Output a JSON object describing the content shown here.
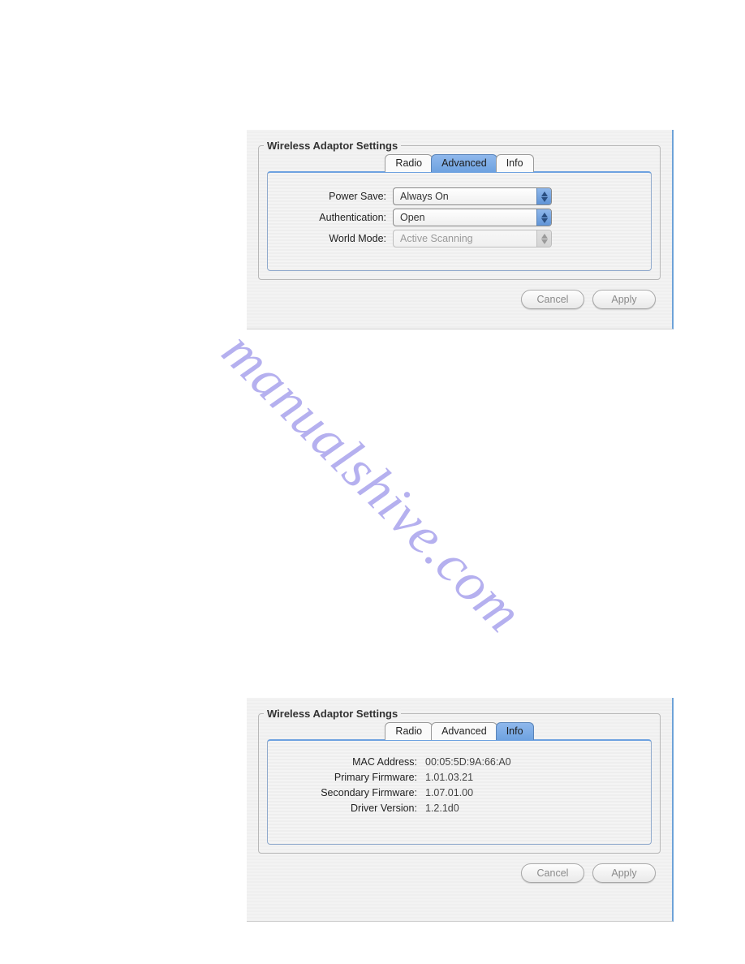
{
  "watermark": "manualshive.com",
  "panel1": {
    "group_title": "Wireless Adaptor Settings",
    "tabs": {
      "radio": "Radio",
      "advanced": "Advanced",
      "info": "Info"
    },
    "active_tab": "advanced",
    "rows": {
      "power_save": {
        "label": "Power Save:",
        "value": "Always On"
      },
      "authentication": {
        "label": "Authentication:",
        "value": "Open"
      },
      "world_mode": {
        "label": "World Mode:",
        "value": "Active Scanning"
      }
    },
    "buttons": {
      "cancel": "Cancel",
      "apply": "Apply"
    }
  },
  "panel2": {
    "group_title": "Wireless Adaptor Settings",
    "tabs": {
      "radio": "Radio",
      "advanced": "Advanced",
      "info": "Info"
    },
    "active_tab": "info",
    "info": {
      "mac": {
        "label": "MAC Address:",
        "value": "00:05:5D:9A:66:A0"
      },
      "primary": {
        "label": "Primary Firmware:",
        "value": "1.01.03.21"
      },
      "secondary": {
        "label": "Secondary Firmware:",
        "value": "1.07.01.00"
      },
      "driver": {
        "label": "Driver Version:",
        "value": "1.2.1d0"
      }
    },
    "buttons": {
      "cancel": "Cancel",
      "apply": "Apply"
    }
  }
}
